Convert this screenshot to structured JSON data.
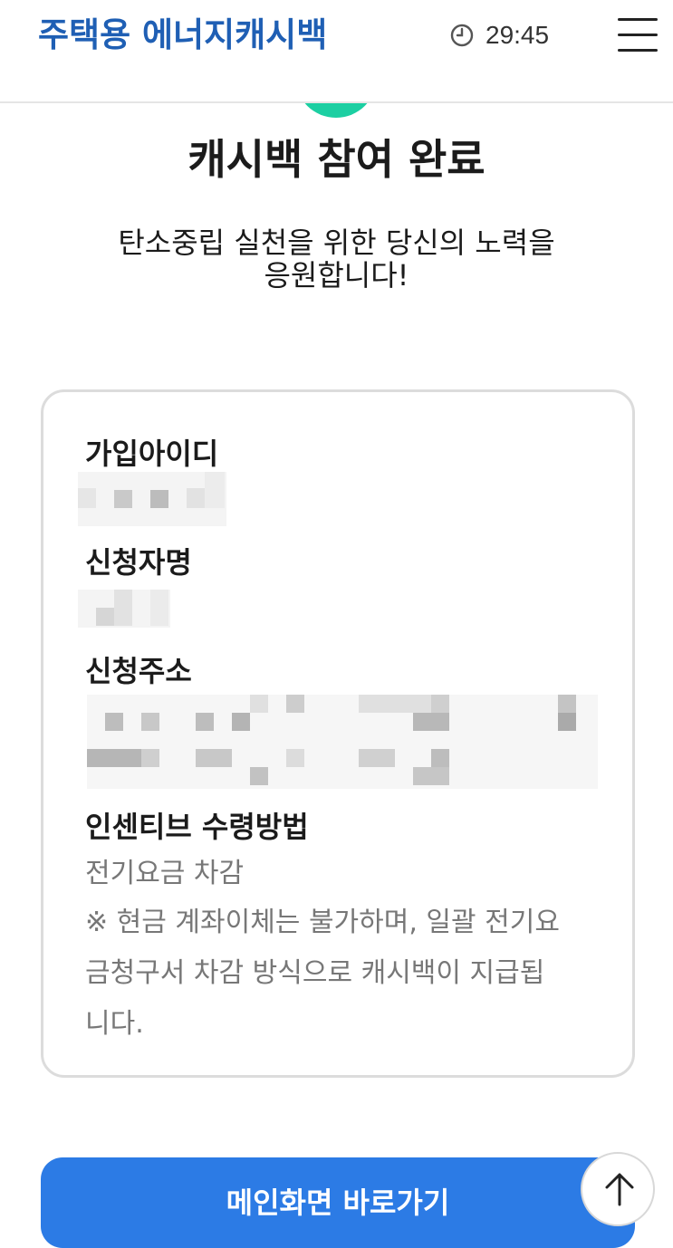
{
  "header": {
    "logo_text": "주택용 에너지캐시백",
    "timer": "29:45",
    "icons": {
      "timer": "clock-icon",
      "menu": "hamburger-menu-icon"
    }
  },
  "status": {
    "icon": "success-check-icon",
    "accent_color": "#1ccfa2"
  },
  "main": {
    "title": "캐시백 참여 완료",
    "subtitle_line1": "탄소중립 실천을 위한 당신의 노력을",
    "subtitle_line2": "응원합니다!"
  },
  "card": {
    "fields": [
      {
        "label": "가입아이디"
      },
      {
        "label": "신청자명"
      },
      {
        "label": "신청주소"
      },
      {
        "label": "인센티브 수령방법",
        "value": "전기요금 차감"
      }
    ],
    "note_line1": "※ 현금 계좌이체는 불가하며, 일괄 전기요",
    "note_line2": "금청구서 차감 방식으로 캐시백이 지급됩",
    "note_line3": "니다."
  },
  "footer": {
    "main_button_label": "메인화면 바로가기",
    "scroll_top_icon": "arrow-up-icon",
    "button_color": "#2c7be5"
  }
}
